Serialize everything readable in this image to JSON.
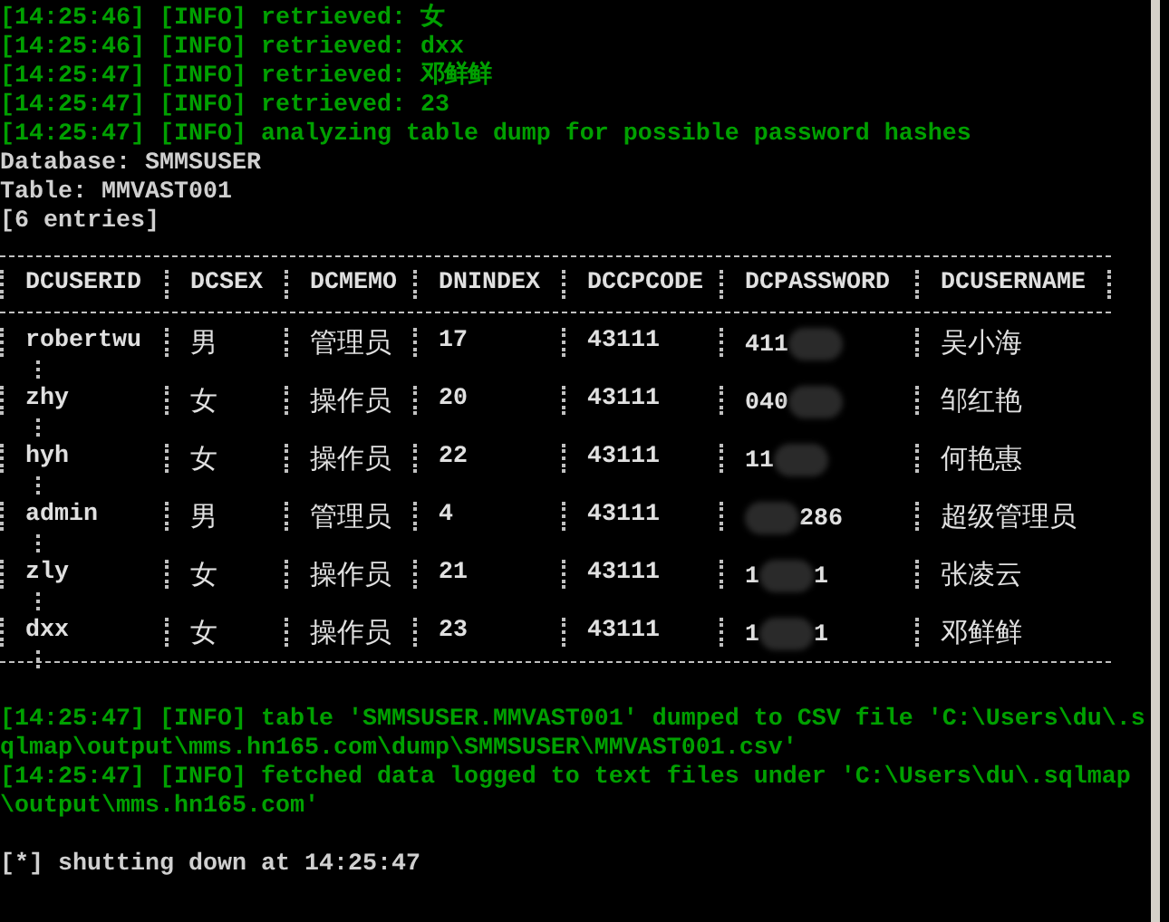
{
  "log_top": [
    {
      "kind": "info",
      "text": "[14:25:46] [INFO] retrieved: 女"
    },
    {
      "kind": "info",
      "text": "[14:25:46] [INFO] retrieved: dxx"
    },
    {
      "kind": "info",
      "text": "[14:25:47] [INFO] retrieved: 邓鲜鲜"
    },
    {
      "kind": "info",
      "text": "[14:25:47] [INFO] retrieved: 23"
    },
    {
      "kind": "info",
      "text": "[14:25:47] [INFO] analyzing table dump for possible password hashes"
    },
    {
      "kind": "plain",
      "text": "Database: SMMSUSER"
    },
    {
      "kind": "plain",
      "text": "Table: MMVAST001"
    },
    {
      "kind": "plain",
      "text": "[6 entries]"
    }
  ],
  "table": {
    "columns": [
      "DCUSERID",
      "DCSEX",
      "DCMEMO",
      "DNINDEX",
      "DCCPCODE",
      "DCPASSWORD",
      "DCUSERNAME"
    ],
    "rows": [
      {
        "dcuserid": "robertwu",
        "dcsex": "男",
        "dcmemo": "管理员",
        "dnindex": "17",
        "dccpcode": "43111",
        "password_start": "411",
        "dcusername": "吴小海"
      },
      {
        "dcuserid": "zhy",
        "dcsex": "女",
        "dcmemo": "操作员",
        "dnindex": "20",
        "dccpcode": "43111",
        "password_start": "040",
        "dcusername": "邹红艳"
      },
      {
        "dcuserid": "hyh",
        "dcsex": "女",
        "dcmemo": "操作员",
        "dnindex": "22",
        "dccpcode": "43111",
        "password_start": "11",
        "dcusername": "何艳惠"
      },
      {
        "dcuserid": "admin",
        "dcsex": "男",
        "dcmemo": "管理员",
        "dnindex": "4",
        "dccpcode": "43111",
        "password_end": "286",
        "dcusername": "超级管理员"
      },
      {
        "dcuserid": "zly",
        "dcsex": "女",
        "dcmemo": "操作员",
        "dnindex": "21",
        "dccpcode": "43111",
        "password_start": "1",
        "password_end": "1",
        "dcusername": "张凌云"
      },
      {
        "dcuserid": "dxx",
        "dcsex": "女",
        "dcmemo": "操作员",
        "dnindex": "23",
        "dccpcode": "43111",
        "password_start": "1",
        "password_end": "1",
        "dcusername": "邓鲜鲜"
      }
    ]
  },
  "log_bottom": [
    {
      "kind": "blank"
    },
    {
      "kind": "info",
      "text": "[14:25:47] [INFO] table 'SMMSUSER.MMVAST001' dumped to CSV file 'C:\\Users\\du\\.sqlmap\\output\\mms.hn165.com\\dump\\SMMSUSER\\MMVAST001.csv'"
    },
    {
      "kind": "info",
      "text": "[14:25:47] [INFO] fetched data logged to text files under 'C:\\Users\\du\\.sqlmap\\output\\mms.hn165.com'"
    },
    {
      "kind": "blank"
    },
    {
      "kind": "plain",
      "text": "[*] shutting down at 14:25:47"
    }
  ]
}
